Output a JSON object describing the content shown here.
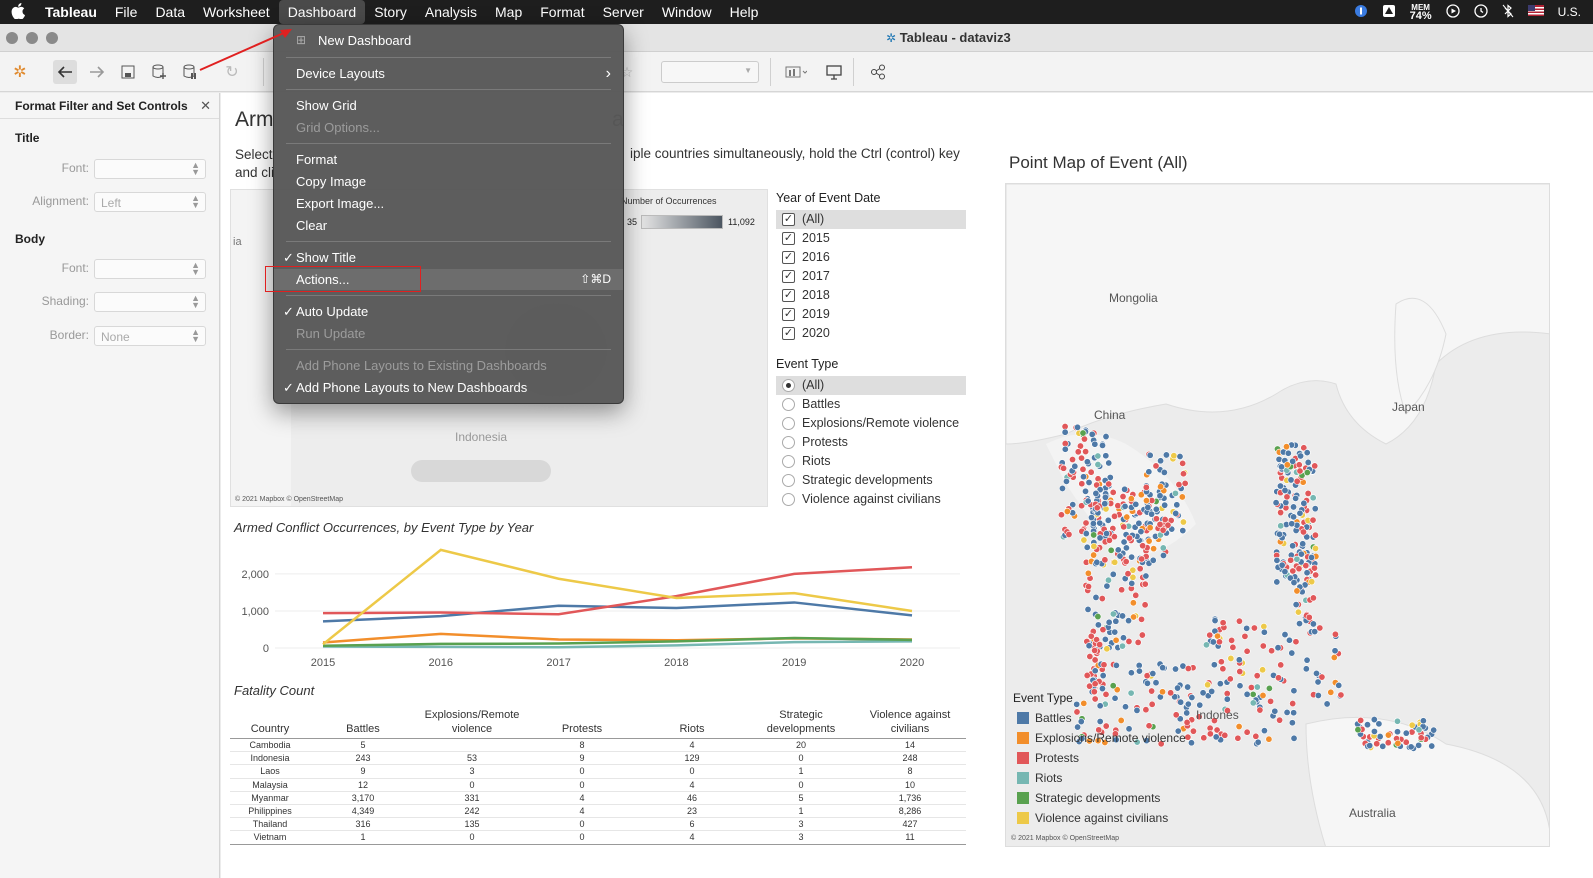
{
  "menubar": {
    "apple": "",
    "items": [
      "Tableau",
      "File",
      "Data",
      "Worksheet",
      "Dashboard",
      "Story",
      "Analysis",
      "Map",
      "Format",
      "Server",
      "Window",
      "Help"
    ],
    "active": "Dashboard",
    "mem_label": "MEM",
    "mem_value": "74%",
    "locale": "U.S."
  },
  "window": {
    "title": "Tableau - dataviz3"
  },
  "left_panel": {
    "title": "Format Filter and Set Controls",
    "section_title": "Title",
    "section_body": "Body",
    "font_label": "Font:",
    "alignment_label": "Alignment:",
    "alignment_value": "Left",
    "shading_label": "Shading:",
    "border_label": "Border:",
    "border_value": "None"
  },
  "dashboard": {
    "title_left": "Arm",
    "title_right": "a",
    "subtitle_left_1": "Select",
    "subtitle_left_2": "and cli",
    "subtitle_right": "iple countries simultaneously, hold the Ctrl (control) key",
    "map_legend_title": "Number of Occurrences",
    "map_legend_min": "35",
    "map_legend_max": "11,092",
    "map_label_indonesia": "Indonesia",
    "map_label_ia": "ia",
    "map_attribution": "© 2021 Mapbox © OpenStreetMap",
    "year_filter": {
      "title": "Year of Event Date",
      "items": [
        "(All)",
        "2015",
        "2016",
        "2017",
        "2018",
        "2019",
        "2020"
      ]
    },
    "event_filter": {
      "title": "Event Type",
      "items": [
        "(All)",
        "Battles",
        "Explosions/Remote violence",
        "Protests",
        "Riots",
        "Strategic developments",
        "Violence against civilians"
      ],
      "selected": "(All)"
    },
    "line_chart_title": "Armed Conflict Occurrences, by Event Type by Year",
    "fatality_title": "Fatality Count",
    "fatality_table": {
      "headers": [
        "Country",
        "Battles",
        "Explosions/Remote violence",
        "Protests",
        "Riots",
        "Strategic developments",
        "Violence against civilians"
      ],
      "rows": [
        [
          "Cambodia",
          "5",
          "",
          "8",
          "4",
          "20",
          "14"
        ],
        [
          "Indonesia",
          "243",
          "53",
          "9",
          "129",
          "0",
          "248"
        ],
        [
          "Laos",
          "9",
          "3",
          "0",
          "0",
          "1",
          "8"
        ],
        [
          "Malaysia",
          "12",
          "0",
          "0",
          "4",
          "0",
          "10"
        ],
        [
          "Myanmar",
          "3,170",
          "331",
          "4",
          "46",
          "5",
          "1,736"
        ],
        [
          "Philippines",
          "4,349",
          "242",
          "4",
          "23",
          "1",
          "8,286"
        ],
        [
          "Thailand",
          "316",
          "135",
          "0",
          "6",
          "3",
          "427"
        ],
        [
          "Vietnam",
          "1",
          "0",
          "0",
          "4",
          "3",
          "11"
        ]
      ]
    },
    "point_map": {
      "title": "Point Map of Event (All)",
      "labels": {
        "mongolia": "Mongolia",
        "china": "China",
        "japan": "Japan",
        "indonesia": "Indones",
        "australia": "Australia"
      },
      "legend_title": "Event Type",
      "legend": [
        {
          "name": "Battles",
          "color": "#4e79a7"
        },
        {
          "name": "Explosions/Remote violence",
          "color": "#f28e2b"
        },
        {
          "name": "Protests",
          "color": "#e15759"
        },
        {
          "name": "Riots",
          "color": "#76b7b2"
        },
        {
          "name": "Strategic developments",
          "color": "#59a14f"
        },
        {
          "name": "Violence against civilians",
          "color": "#edc948"
        }
      ],
      "attribution": "© 2021 Mapbox © OpenStreetMap"
    }
  },
  "chart_data": {
    "type": "line",
    "title": "Armed Conflict Occurrences, by Event Type by Year",
    "x": [
      "2015",
      "2016",
      "2017",
      "2018",
      "2019",
      "2020"
    ],
    "ylim": [
      0,
      2700
    ],
    "yticks": [
      "2,000",
      "1,000",
      "0"
    ],
    "series": [
      {
        "name": "Battles",
        "color": "#4e79a7",
        "values": [
          720,
          860,
          1140,
          1080,
          1230,
          880
        ]
      },
      {
        "name": "Explosions/Remote violence",
        "color": "#f28e2b",
        "values": [
          150,
          380,
          230,
          210,
          260,
          230
        ]
      },
      {
        "name": "Protests",
        "color": "#e15759",
        "values": [
          940,
          960,
          910,
          1400,
          2000,
          2180
        ]
      },
      {
        "name": "Riots",
        "color": "#76b7b2",
        "values": [
          40,
          30,
          20,
          70,
          160,
          180
        ]
      },
      {
        "name": "Strategic developments",
        "color": "#59a14f",
        "values": [
          60,
          110,
          120,
          180,
          270,
          220
        ]
      },
      {
        "name": "Violence against civilians",
        "color": "#edc948",
        "values": [
          100,
          2650,
          1870,
          1350,
          1480,
          1000
        ]
      }
    ]
  },
  "dropdown": {
    "items": [
      {
        "label": "New Dashboard",
        "disabled": false,
        "check": false
      },
      {
        "label": "Device Layouts",
        "disabled": false,
        "check": false,
        "submenu": true
      },
      {
        "label": "Show Grid",
        "disabled": false,
        "check": false
      },
      {
        "label": "Grid Options...",
        "disabled": true,
        "check": false
      },
      {
        "label": "Format",
        "disabled": false,
        "check": false
      },
      {
        "label": "Copy Image",
        "disabled": false,
        "check": false
      },
      {
        "label": "Export Image...",
        "disabled": false,
        "check": false
      },
      {
        "label": "Clear",
        "disabled": false,
        "check": false
      },
      {
        "label": "Show Title",
        "disabled": false,
        "check": true
      },
      {
        "label": "Actions...",
        "disabled": false,
        "check": false,
        "shortcut": "⇧⌘D",
        "highlighted": true
      },
      {
        "label": "Auto Update",
        "disabled": false,
        "check": true
      },
      {
        "label": "Run Update",
        "disabled": true,
        "check": false
      },
      {
        "label": "Add Phone Layouts to Existing Dashboards",
        "disabled": true,
        "check": false
      },
      {
        "label": "Add Phone Layouts to New Dashboards",
        "disabled": false,
        "check": true
      }
    ],
    "check_mark": "✓",
    "submenu_arrow": "›"
  }
}
